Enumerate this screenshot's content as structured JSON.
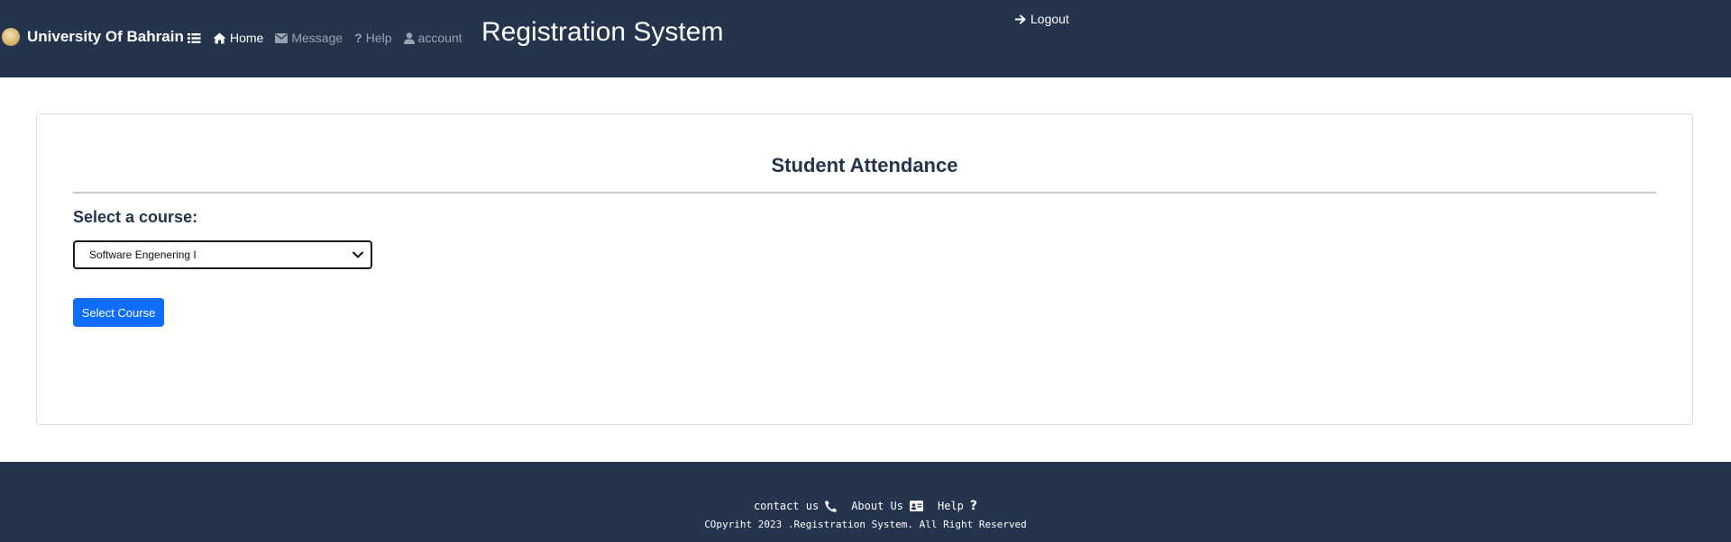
{
  "header": {
    "brand": "University Of Bahrain",
    "app_title": "Registration System",
    "logout_label": "Logout",
    "nav": [
      {
        "label": "Home",
        "icon": "home-icon"
      },
      {
        "label": "Message",
        "icon": "envelope-icon"
      },
      {
        "label": "Help",
        "icon": "question-icon"
      },
      {
        "label": "account",
        "icon": "user-icon"
      }
    ]
  },
  "main": {
    "title": "Student Attendance",
    "course_label": "Select a course:",
    "selected_course": "Software Engenering I",
    "button_label": "Select Course"
  },
  "footer": {
    "links": [
      {
        "label": "contact us",
        "icon": "phone-icon"
      },
      {
        "label": "About Us",
        "icon": "id-card-icon"
      },
      {
        "label": "Help",
        "icon": "question-icon"
      }
    ],
    "copyright": "COpyriht 2023 .Registration System. All Right Reserved"
  },
  "colors": {
    "header_bg": "#24344c",
    "nav_inactive": "#9aa3ad",
    "primary_button": "#0d6efd"
  }
}
